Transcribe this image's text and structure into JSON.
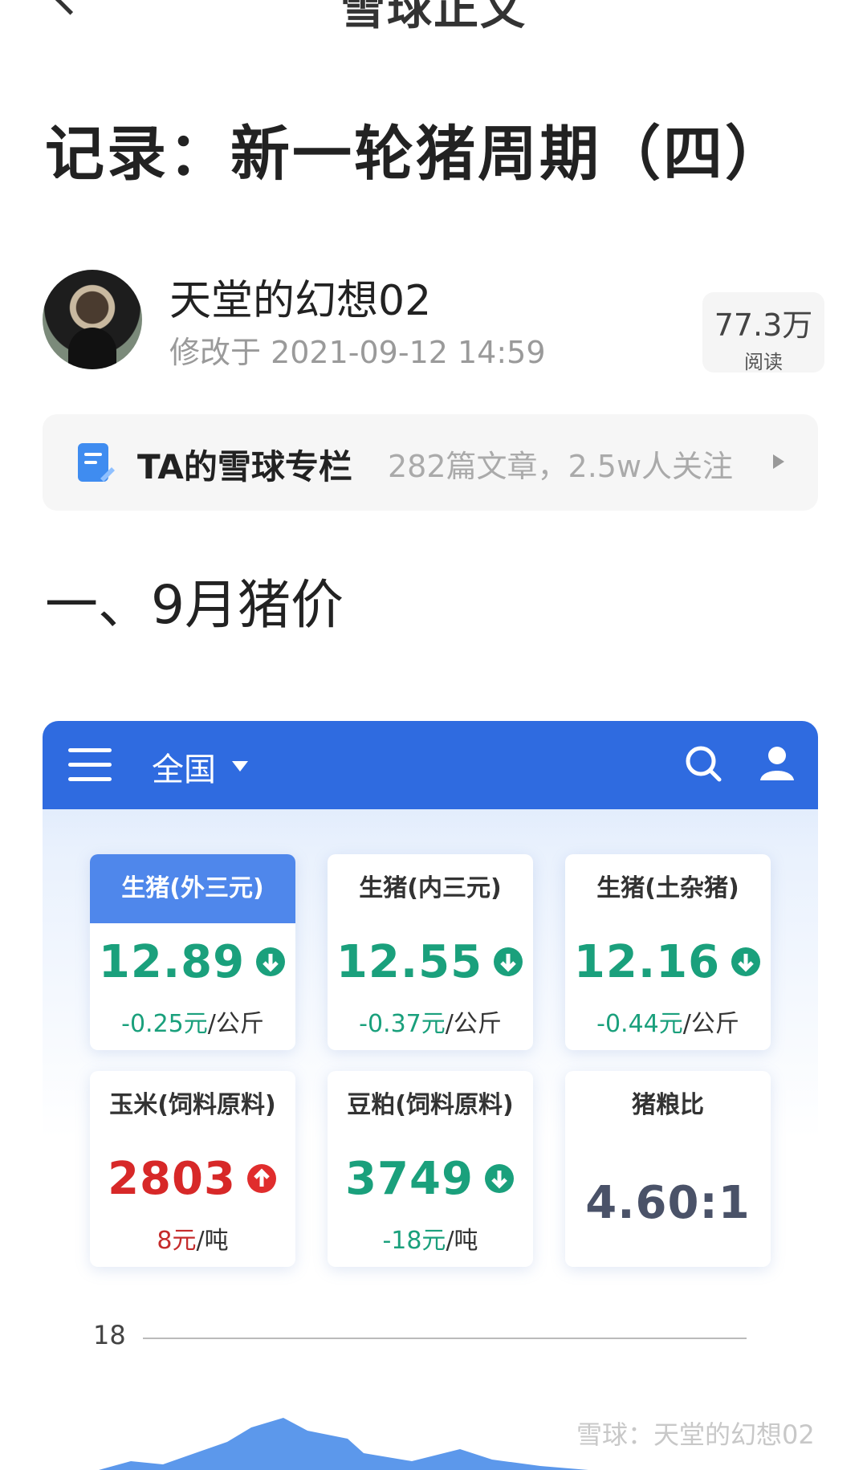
{
  "header": {
    "title_partial": "雪球正文"
  },
  "article": {
    "title": "记录：新一轮猪周期（四）",
    "author": "天堂的幻想02",
    "modified": "修改于 2021-09-12 14:59",
    "reads": {
      "count": "77.3万",
      "label": "阅读"
    },
    "column": {
      "title": "TA的雪球专栏",
      "stats": "282篇文章，2.5w人关注"
    },
    "section_heading": "一、9月猪价"
  },
  "app": {
    "region": "全国",
    "cards": [
      {
        "label": "生猪(外三元)",
        "price": "12.89",
        "trend": "down",
        "change": "-0.25元",
        "unit": "/公斤"
      },
      {
        "label": "生猪(内三元)",
        "price": "12.55",
        "trend": "down",
        "change": "-0.37元",
        "unit": "/公斤"
      },
      {
        "label": "生猪(土杂猪)",
        "price": "12.16",
        "trend": "down",
        "change": "-0.44元",
        "unit": "/公斤"
      },
      {
        "label": "玉米(饲料原料)",
        "price": "2803",
        "trend": "up",
        "change": "8元",
        "unit": "/吨"
      },
      {
        "label": "豆粕(饲料原料)",
        "price": "3749",
        "trend": "down",
        "change": "-18元",
        "unit": "/吨"
      },
      {
        "label": "猪粮比",
        "price": "4.60:1"
      }
    ],
    "chart": {
      "y_tick": "18"
    }
  },
  "watermark": "雪球：天堂的幻想02",
  "colors": {
    "app_bar": "#2f6be0",
    "down": "#1aa07c",
    "up": "#d72828",
    "active_tab": "#4f87eb"
  }
}
